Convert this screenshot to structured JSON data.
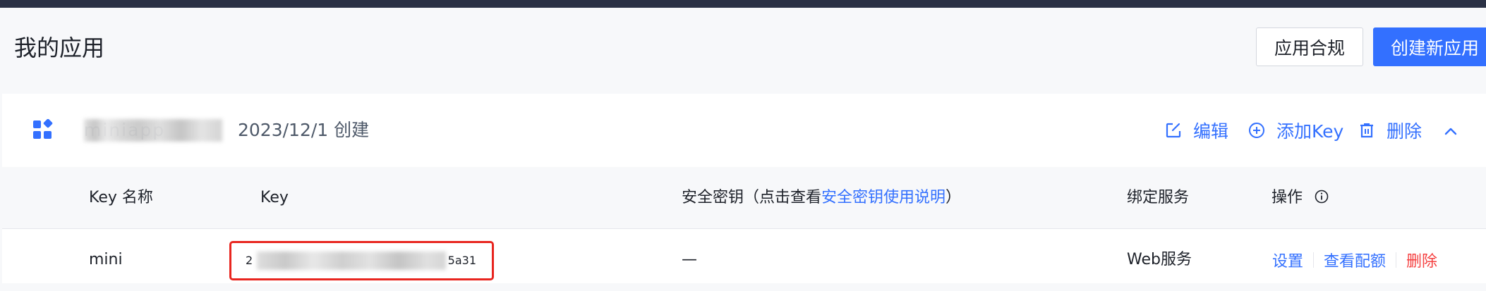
{
  "header": {
    "page_title": "我的应用",
    "compliance_label": "应用合规",
    "create_label": "创建新应用"
  },
  "app": {
    "name": "miniapp",
    "created": "2023/12/1 创建",
    "actions": {
      "edit": "编辑",
      "add_key": "添加Key",
      "delete": "删除"
    }
  },
  "table": {
    "columns": {
      "key_name": "Key 名称",
      "key": "Key",
      "secret_prefix": "安全密钥（点击查看",
      "secret_link": "安全密钥使用说明",
      "secret_suffix": "）",
      "service": "绑定服务",
      "ops": "操作"
    },
    "rows": [
      {
        "key_name": "mini",
        "key_start": "2",
        "key_end": "5a31",
        "secret": "—",
        "service": "Web服务",
        "ops": {
          "settings": "设置",
          "quota": "查看配额",
          "delete": "删除"
        }
      }
    ]
  },
  "colors": {
    "primary": "#3370ff",
    "danger": "#f53f3f",
    "highlight": "#e8251f",
    "topbar": "#2b3145"
  },
  "icons": {
    "app": "app-grid-icon",
    "edit": "edit-icon",
    "add": "plus-circle-icon",
    "delete": "trash-icon",
    "collapse": "chevron-up-icon",
    "info": "info-circle-icon"
  }
}
